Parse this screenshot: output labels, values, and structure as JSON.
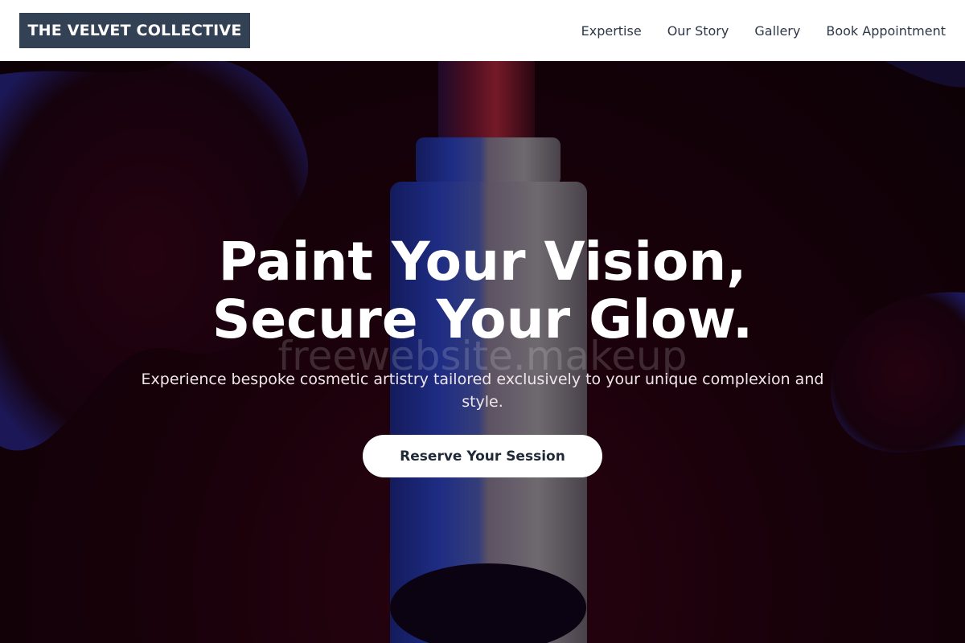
{
  "header": {
    "logo": "THE VELVET COLLECTIVE",
    "nav": [
      {
        "label": "Expertise"
      },
      {
        "label": "Our Story"
      },
      {
        "label": "Gallery"
      },
      {
        "label": "Book Appointment"
      }
    ]
  },
  "hero": {
    "title_line1": "Paint Your Vision,",
    "title_line2": "Secure Your Glow.",
    "watermark": "freewebsite.makeup",
    "subtitle": "Experience bespoke cosmetic artistry tailored exclusively to your unique complexion and style.",
    "cta_label": "Reserve Your Session",
    "background_image": "lipstick-tube-on-dark-crimson-backdrop"
  },
  "colors": {
    "logo_bg": "#334155",
    "nav_text": "#2d3748",
    "hero_bg": "#22030d",
    "cta_bg": "#ffffff",
    "cta_text": "#1f2937"
  }
}
